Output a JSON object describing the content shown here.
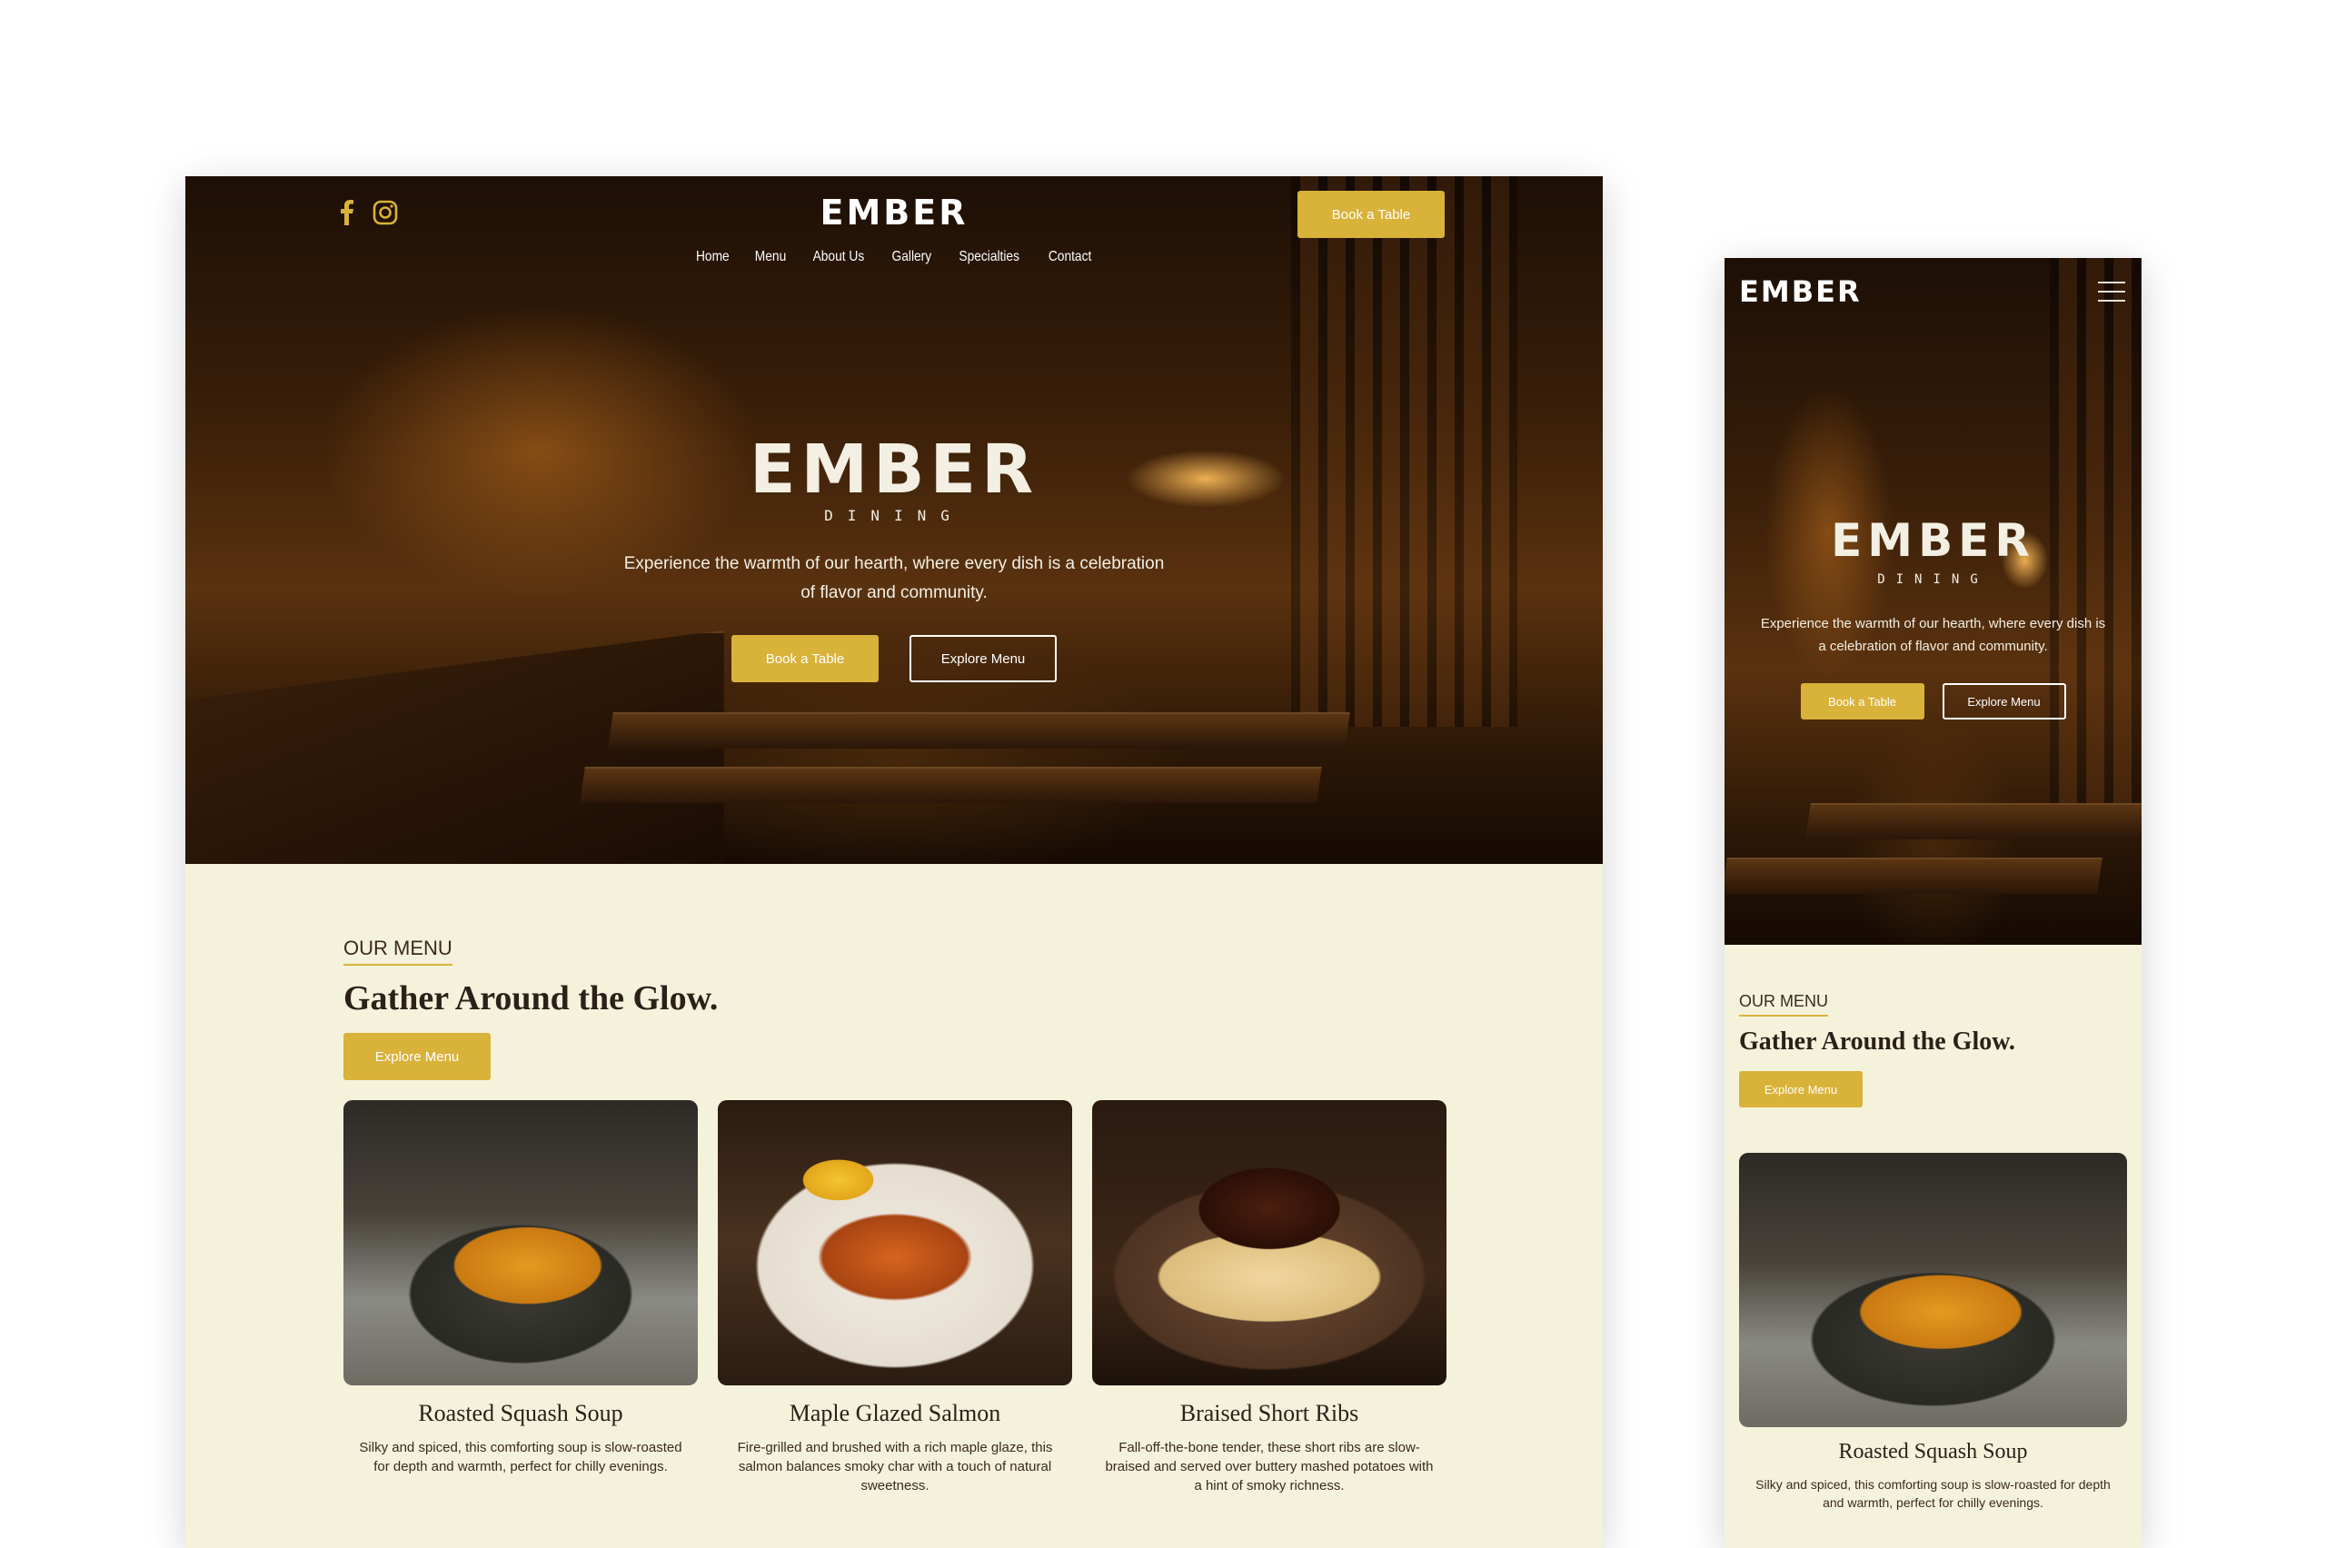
{
  "desktop": {
    "header": {
      "logo": "EMBER",
      "social": [
        {
          "icon": "facebook-icon"
        },
        {
          "icon": "instagram-icon"
        }
      ],
      "nav": [
        "Home",
        "Menu",
        "About Us",
        "Gallery",
        "Specialties",
        "Contact"
      ],
      "book_button": "Book a Table"
    },
    "hero": {
      "brand": "EMBER",
      "brand_sub": "DINING",
      "tagline": "Experience the warmth of our hearth, where every dish is a celebration of flavor and community.",
      "primary_button": "Book a Table",
      "secondary_button": "Explore Menu"
    },
    "menu_section": {
      "eyebrow": "OUR MENU",
      "title": "Gather Around the Glow.",
      "button": "Explore Menu",
      "items": [
        {
          "title": "Roasted Squash Soup",
          "description": "Silky and spiced, this comforting soup is slow-roasted for depth and warmth, perfect for chilly evenings."
        },
        {
          "title": "Maple Glazed Salmon",
          "description": "Fire-grilled and brushed with a rich maple glaze, this salmon balances smoky char with a touch of natural sweetness."
        },
        {
          "title": "Braised Short Ribs",
          "description": "Fall-off-the-bone tender, these short ribs are slow-braised and served over buttery mashed potatoes with a hint of smoky richness."
        }
      ]
    }
  },
  "mobile": {
    "header": {
      "logo": "EMBER",
      "menu_icon": "hamburger-icon"
    },
    "hero": {
      "brand": "EMBER",
      "brand_sub": "DINING",
      "tagline": "Experience the warmth of our hearth, where every dish is a celebration of flavor and community.",
      "primary_button": "Book a Table",
      "secondary_button": "Explore Menu"
    },
    "menu_section": {
      "eyebrow": "OUR MENU",
      "title": "Gather Around the Glow.",
      "button": "Explore Menu",
      "items": [
        {
          "title": "Roasted Squash Soup",
          "description": "Silky and spiced, this comforting soup is slow-roasted for depth and warmth, perfect for chilly evenings."
        }
      ]
    }
  },
  "colors": {
    "accent": "#d9b23a",
    "cream_bg": "#f5f2dc",
    "dark_text": "#2b2118"
  }
}
